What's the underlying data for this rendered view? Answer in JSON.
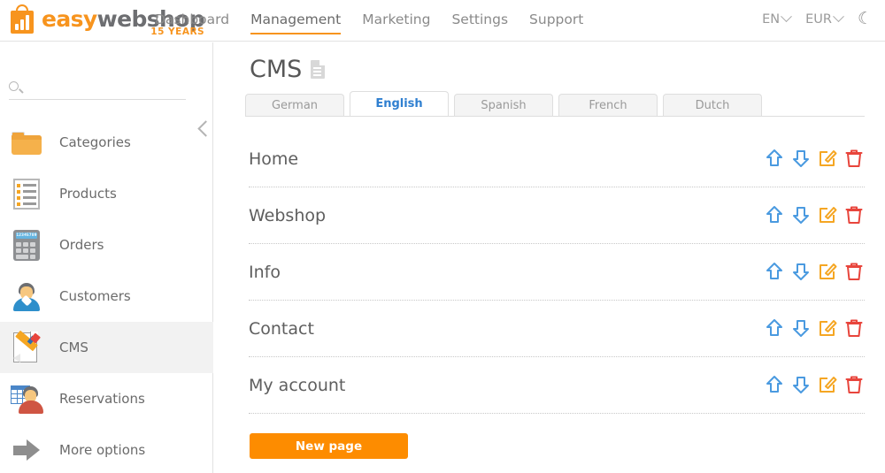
{
  "header": {
    "logo": {
      "easy": "easy",
      "webshop": "webshop",
      "years": "15 YEARS",
      "icon": "shopping-bag-chart-icon"
    },
    "nav": [
      {
        "label": "Dashboard",
        "active": false
      },
      {
        "label": "Management",
        "active": true
      },
      {
        "label": "Marketing",
        "active": false
      },
      {
        "label": "Settings",
        "active": false
      },
      {
        "label": "Support",
        "active": false
      }
    ],
    "language": "EN",
    "currency": "EUR",
    "theme_toggle_icon": "moon-icon"
  },
  "sidebar": {
    "search": {
      "value": "",
      "placeholder": "",
      "icon": "search-icon"
    },
    "collapse_icon": "chevron-left-icon",
    "items": [
      {
        "label": "Categories",
        "icon": "folder-icon",
        "active": false
      },
      {
        "label": "Products",
        "icon": "product-list-icon",
        "active": false
      },
      {
        "label": "Orders",
        "icon": "calculator-icon",
        "active": false
      },
      {
        "label": "Customers",
        "icon": "customer-icon",
        "active": false
      },
      {
        "label": "CMS",
        "icon": "cms-edit-icon",
        "active": true
      },
      {
        "label": "Reservations",
        "icon": "reservations-icon",
        "active": false
      },
      {
        "label": "More options",
        "icon": "arrow-right-icon",
        "active": false
      }
    ]
  },
  "main": {
    "title": "CMS",
    "title_icon": "document-icon",
    "tabs": [
      {
        "label": "German",
        "active": false
      },
      {
        "label": "English",
        "active": true
      },
      {
        "label": "Spanish",
        "active": false
      },
      {
        "label": "French",
        "active": false
      },
      {
        "label": "Dutch",
        "active": false
      }
    ],
    "pages": [
      {
        "name": "Home"
      },
      {
        "name": "Webshop"
      },
      {
        "name": "Info"
      },
      {
        "name": "Contact"
      },
      {
        "name": "My account"
      }
    ],
    "row_actions": [
      {
        "name": "move-up-icon",
        "title": "Move up"
      },
      {
        "name": "move-down-icon",
        "title": "Move down"
      },
      {
        "name": "edit-icon",
        "title": "Edit"
      },
      {
        "name": "delete-icon",
        "title": "Delete"
      }
    ],
    "new_page_button": "New page"
  },
  "colors": {
    "brand_orange": "#f7941e",
    "button_orange": "#fd8c00",
    "active_tab_blue": "#2f7fd0",
    "arrow_blue": "#4a9ae0",
    "edit_orange": "#f5a623",
    "delete_red": "#e8453c",
    "text_gray": "#5e5e5e"
  }
}
